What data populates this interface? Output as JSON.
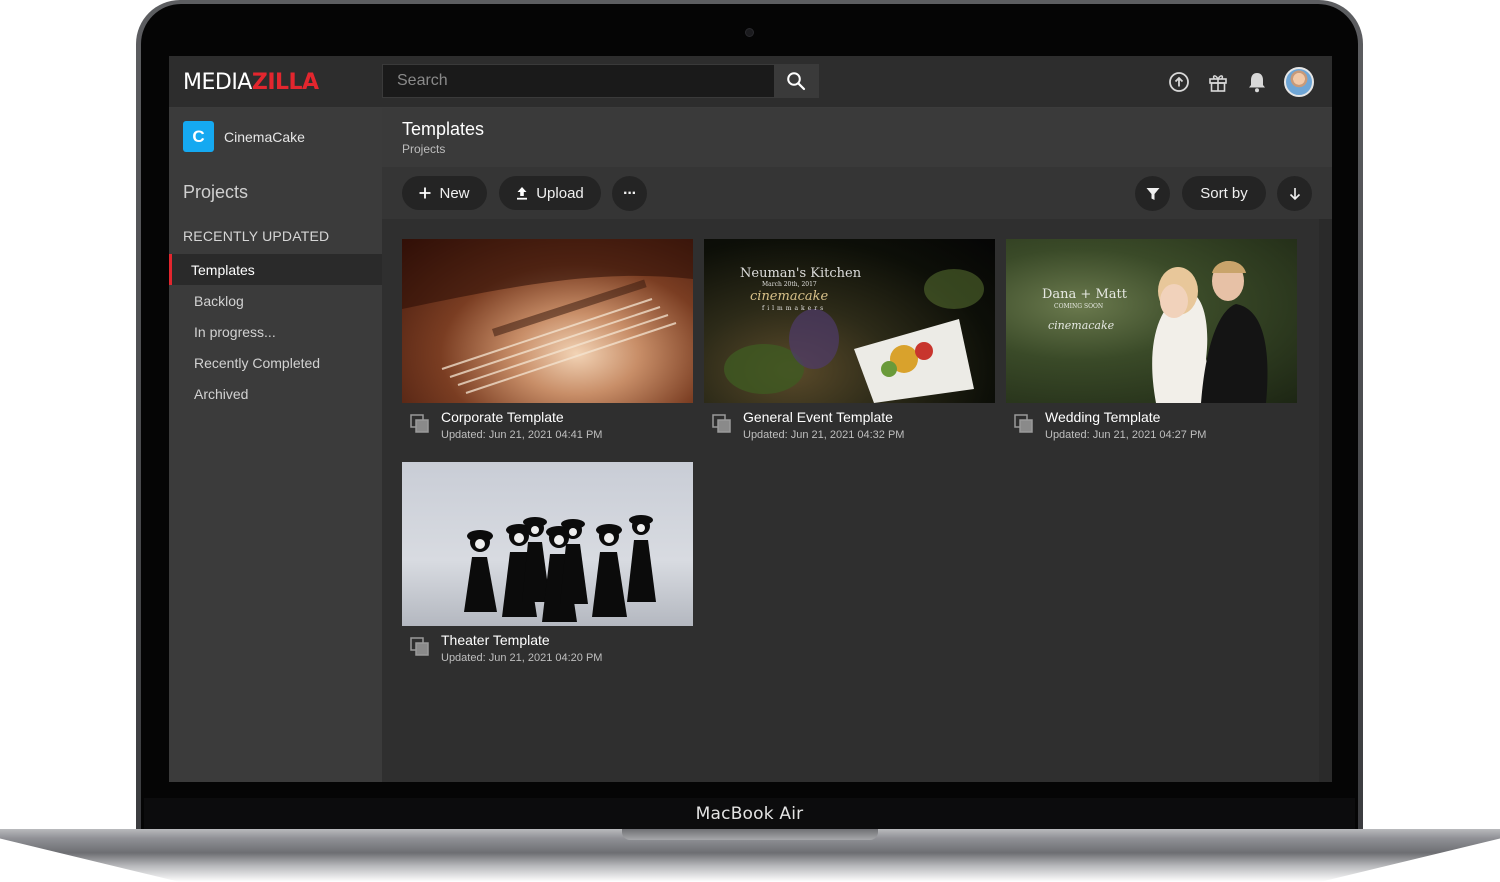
{
  "device": {
    "model_label": "MacBook Air"
  },
  "app": {
    "logo_part1": "MEDIA",
    "logo_part2": "ZILLA",
    "brand_color": "#e3262e",
    "search": {
      "placeholder": "Search"
    },
    "top_icons": [
      "upload-circle-icon",
      "gift-icon",
      "bell-icon",
      "avatar"
    ]
  },
  "sidebar": {
    "workspace": {
      "initial": "C",
      "name": "CinemaCake",
      "color": "#15a9f1"
    },
    "heading": "Projects",
    "section_label": "RECENTLY UPDATED",
    "items": [
      {
        "label": "Templates",
        "active": true
      },
      {
        "label": "Backlog",
        "active": false
      },
      {
        "label": "In progress...",
        "active": false
      },
      {
        "label": "Recently Completed",
        "active": false
      },
      {
        "label": "Archived",
        "active": false
      }
    ]
  },
  "header": {
    "title": "Templates",
    "breadcrumb": "Projects"
  },
  "toolbar": {
    "new_label": "New",
    "upload_label": "Upload",
    "more_label": "···",
    "sort_label": "Sort by"
  },
  "cards": [
    {
      "title": "Corporate Template",
      "updated": "Updated: Jun 21, 2021 04:41 PM"
    },
    {
      "title": "General Event Template",
      "updated": "Updated: Jun 21, 2021 04:32 PM",
      "thumb_text": {
        "line1": "Neuman's Kitchen",
        "line2": "March 20th, 2017",
        "line3": "cinemacake",
        "line4": "filmmakers"
      }
    },
    {
      "title": "Wedding Template",
      "updated": "Updated: Jun 21, 2021 04:27 PM",
      "thumb_text": {
        "line1": "Dana + Matt",
        "line2": "COMING SOON",
        "line3": "cinemacake"
      }
    },
    {
      "title": "Theater Template",
      "updated": "Updated: Jun 21, 2021 04:20 PM"
    }
  ]
}
